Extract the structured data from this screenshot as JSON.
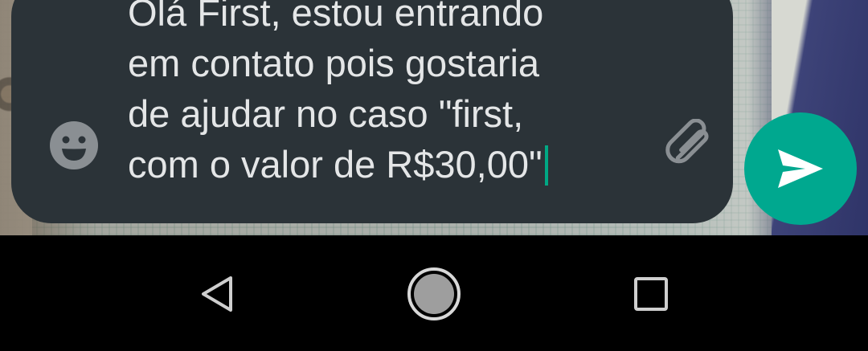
{
  "composer": {
    "message_lines": [
      "Olá First, estou entrando",
      "em contato pois gostaria",
      "de ajudar no caso \"first,",
      "com o valor de R$30,00\""
    ],
    "emoji_icon": "emoji-smile-icon",
    "attach_icon": "paperclip-icon",
    "send_icon": "send-arrow-icon"
  },
  "navigation": {
    "back_icon": "triangle-back-icon",
    "home_icon": "circle-home-icon",
    "recents_icon": "square-recents-icon"
  },
  "colors": {
    "composer_background": "#2b3338",
    "send_button": "#00a88f",
    "caret": "#00a884",
    "text": "#e4e6e7",
    "nav_background": "#000000"
  }
}
